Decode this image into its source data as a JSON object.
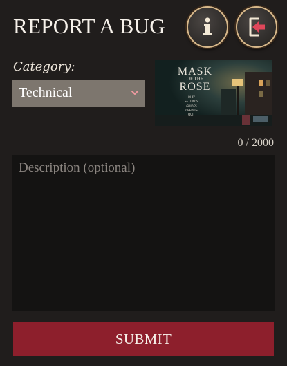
{
  "header": {
    "title": "REPORT A BUG",
    "info_icon": "info-icon",
    "exit_icon": "exit-icon"
  },
  "form": {
    "category_label": "Category:",
    "category_value": "Technical",
    "char_counter": "0 / 2000",
    "description_placeholder": "Description (optional)",
    "submit_label": "SUBMIT"
  },
  "screenshot": {
    "title_line1": "MASK",
    "title_line2": "OF THE",
    "title_line3": "ROSE",
    "menu": [
      "PLAY",
      "SETTINGS",
      "GUIDES",
      "CREDITS",
      "QUIT"
    ]
  },
  "colors": {
    "background": "#201d1c",
    "submit": "#8d1f2c",
    "select": "#7d766e",
    "accent_icon": "#e0475a",
    "gold_border": "#d7b88a"
  }
}
